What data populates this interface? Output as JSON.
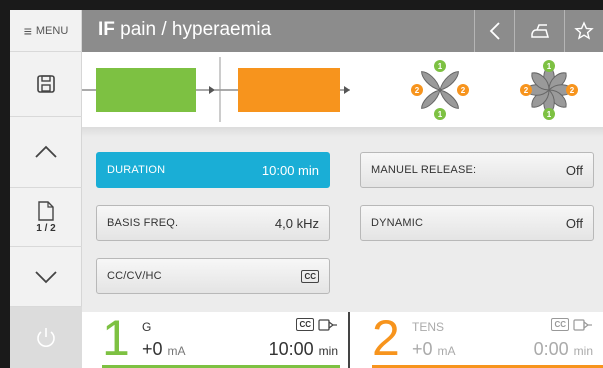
{
  "sidebar": {
    "menu_label": "MENU",
    "page_indicator": "1 / 2"
  },
  "header": {
    "title_bold": "IF",
    "title_rest": "pain / hyperaemia"
  },
  "phases": {
    "colors": [
      "#7dc142",
      "#f7941d"
    ],
    "electrode_badges": [
      "1",
      "2",
      "2",
      "1"
    ]
  },
  "params": {
    "duration": {
      "label": "DURATION",
      "value": "10:00 min"
    },
    "basis_freq": {
      "label": "BASIS FREQ.",
      "value": "4,0 kHz"
    },
    "cc_mode": {
      "label": "CC/CV/HC",
      "value": "CC"
    },
    "manuel_release": {
      "label": "MANUEL RELEASE:",
      "value": "Off"
    },
    "dynamic": {
      "label": "DYNAMIC",
      "value": "Off"
    }
  },
  "channels": [
    {
      "number": "1",
      "name": "G",
      "amplitude": "+0",
      "amp_unit": "mA",
      "time": "10:00",
      "time_unit": "min",
      "badge": "CC",
      "color": "#7dc142"
    },
    {
      "number": "2",
      "name": "TENS",
      "amplitude": "+0",
      "amp_unit": "mA",
      "time": "0:00",
      "time_unit": "min",
      "badge": "CC",
      "color": "#f7941d"
    }
  ]
}
